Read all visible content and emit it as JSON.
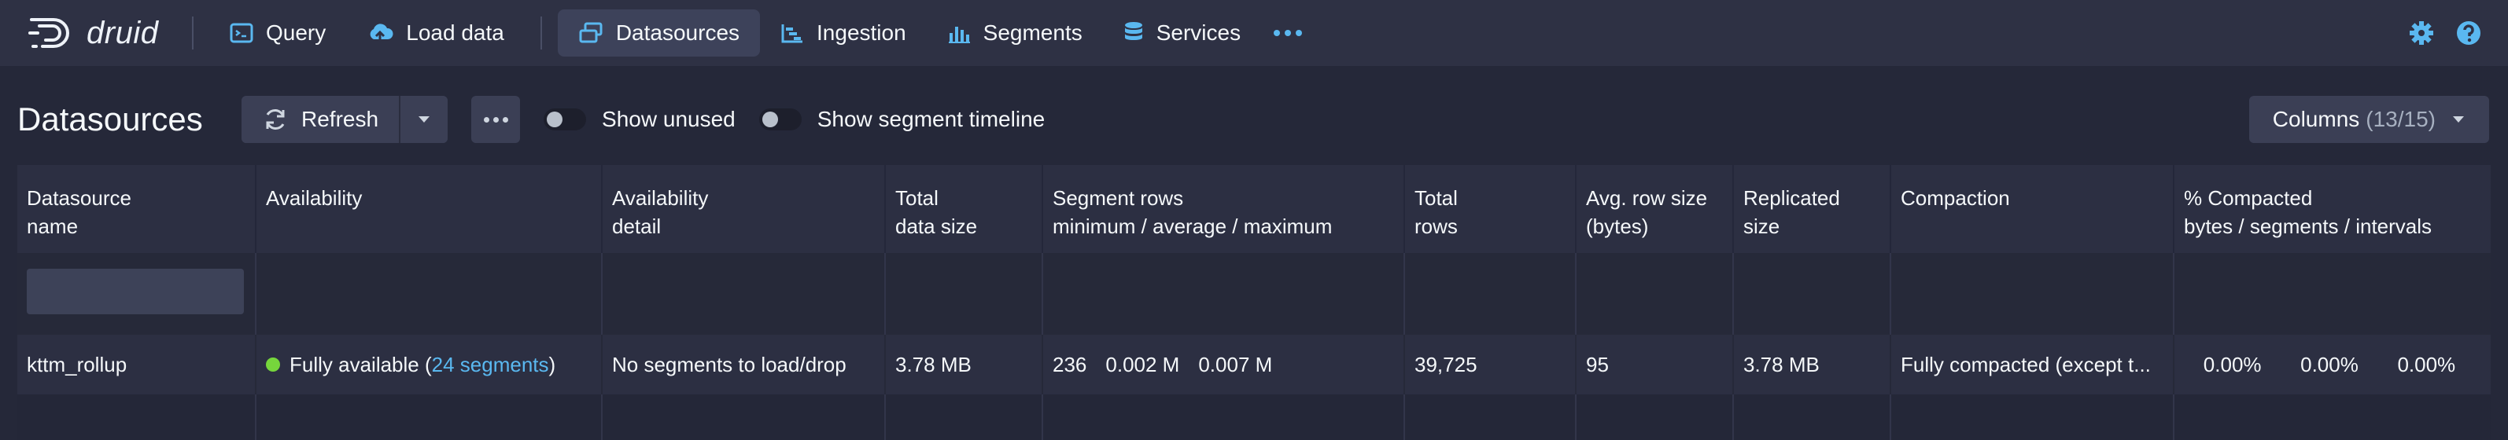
{
  "app": {
    "logo_text": "druid"
  },
  "nav": {
    "items": [
      {
        "label": "Query"
      },
      {
        "label": "Load data"
      },
      {
        "label": "Datasources"
      },
      {
        "label": "Ingestion"
      },
      {
        "label": "Segments"
      },
      {
        "label": "Services"
      }
    ],
    "accent": "#5ab8f0"
  },
  "toolbar": {
    "title": "Datasources",
    "refresh_label": "Refresh",
    "toggle_unused_label": "Show unused",
    "toggle_timeline_label": "Show segment timeline",
    "columns_label": "Columns",
    "columns_count": "(13/15)"
  },
  "table": {
    "headers": [
      [
        "Datasource",
        "name"
      ],
      [
        "Availability",
        ""
      ],
      [
        "Availability",
        "detail"
      ],
      [
        "Total",
        "data size"
      ],
      [
        "Segment rows",
        "minimum / average / maximum"
      ],
      [
        "Total",
        "rows"
      ],
      [
        "Avg. row size",
        "(bytes)"
      ],
      [
        "Replicated",
        "size"
      ],
      [
        "Compaction",
        ""
      ],
      [
        "% Compacted",
        "bytes / segments / intervals"
      ]
    ],
    "row": {
      "name": "kttm_rollup",
      "availability_prefix": "Fully available (",
      "availability_link": "24 segments",
      "availability_suffix": ")",
      "availability_detail": "No segments to load/drop",
      "total_data_size": "3.78 MB",
      "seg_min": "236",
      "seg_avg": "0.002 M",
      "seg_max": "0.007 M",
      "total_rows": "39,725",
      "avg_row_size": "95",
      "replicated_size": "3.78 MB",
      "compaction": "Fully compacted (except t...",
      "pct_bytes": "0.00%",
      "pct_segments": "0.00%",
      "pct_intervals": "0.00%"
    },
    "status_color": "#76d63c"
  }
}
